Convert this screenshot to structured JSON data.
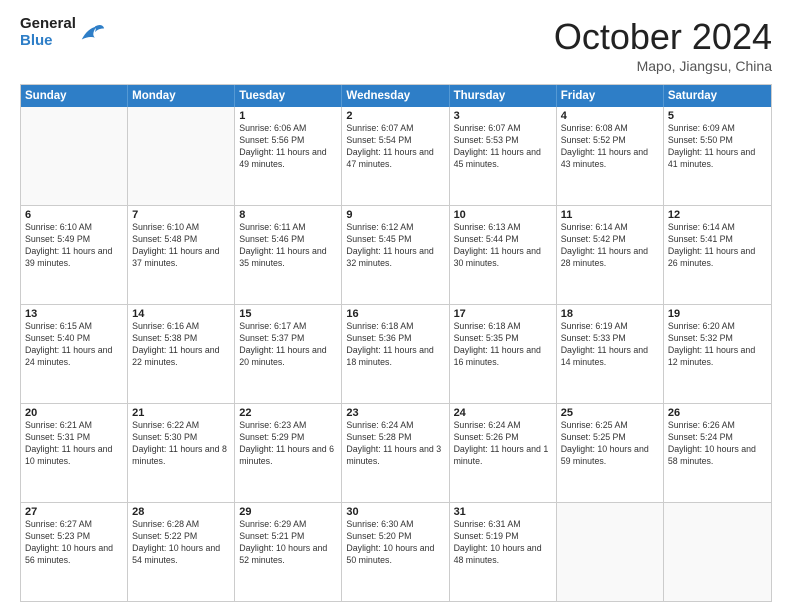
{
  "logo": {
    "line1": "General",
    "line2": "Blue"
  },
  "title": "October 2024",
  "location": "Mapo, Jiangsu, China",
  "header_days": [
    "Sunday",
    "Monday",
    "Tuesday",
    "Wednesday",
    "Thursday",
    "Friday",
    "Saturday"
  ],
  "weeks": [
    [
      {
        "day": "",
        "info": ""
      },
      {
        "day": "",
        "info": ""
      },
      {
        "day": "1",
        "info": "Sunrise: 6:06 AM\nSunset: 5:56 PM\nDaylight: 11 hours and 49 minutes."
      },
      {
        "day": "2",
        "info": "Sunrise: 6:07 AM\nSunset: 5:54 PM\nDaylight: 11 hours and 47 minutes."
      },
      {
        "day": "3",
        "info": "Sunrise: 6:07 AM\nSunset: 5:53 PM\nDaylight: 11 hours and 45 minutes."
      },
      {
        "day": "4",
        "info": "Sunrise: 6:08 AM\nSunset: 5:52 PM\nDaylight: 11 hours and 43 minutes."
      },
      {
        "day": "5",
        "info": "Sunrise: 6:09 AM\nSunset: 5:50 PM\nDaylight: 11 hours and 41 minutes."
      }
    ],
    [
      {
        "day": "6",
        "info": "Sunrise: 6:10 AM\nSunset: 5:49 PM\nDaylight: 11 hours and 39 minutes."
      },
      {
        "day": "7",
        "info": "Sunrise: 6:10 AM\nSunset: 5:48 PM\nDaylight: 11 hours and 37 minutes."
      },
      {
        "day": "8",
        "info": "Sunrise: 6:11 AM\nSunset: 5:46 PM\nDaylight: 11 hours and 35 minutes."
      },
      {
        "day": "9",
        "info": "Sunrise: 6:12 AM\nSunset: 5:45 PM\nDaylight: 11 hours and 32 minutes."
      },
      {
        "day": "10",
        "info": "Sunrise: 6:13 AM\nSunset: 5:44 PM\nDaylight: 11 hours and 30 minutes."
      },
      {
        "day": "11",
        "info": "Sunrise: 6:14 AM\nSunset: 5:42 PM\nDaylight: 11 hours and 28 minutes."
      },
      {
        "day": "12",
        "info": "Sunrise: 6:14 AM\nSunset: 5:41 PM\nDaylight: 11 hours and 26 minutes."
      }
    ],
    [
      {
        "day": "13",
        "info": "Sunrise: 6:15 AM\nSunset: 5:40 PM\nDaylight: 11 hours and 24 minutes."
      },
      {
        "day": "14",
        "info": "Sunrise: 6:16 AM\nSunset: 5:38 PM\nDaylight: 11 hours and 22 minutes."
      },
      {
        "day": "15",
        "info": "Sunrise: 6:17 AM\nSunset: 5:37 PM\nDaylight: 11 hours and 20 minutes."
      },
      {
        "day": "16",
        "info": "Sunrise: 6:18 AM\nSunset: 5:36 PM\nDaylight: 11 hours and 18 minutes."
      },
      {
        "day": "17",
        "info": "Sunrise: 6:18 AM\nSunset: 5:35 PM\nDaylight: 11 hours and 16 minutes."
      },
      {
        "day": "18",
        "info": "Sunrise: 6:19 AM\nSunset: 5:33 PM\nDaylight: 11 hours and 14 minutes."
      },
      {
        "day": "19",
        "info": "Sunrise: 6:20 AM\nSunset: 5:32 PM\nDaylight: 11 hours and 12 minutes."
      }
    ],
    [
      {
        "day": "20",
        "info": "Sunrise: 6:21 AM\nSunset: 5:31 PM\nDaylight: 11 hours and 10 minutes."
      },
      {
        "day": "21",
        "info": "Sunrise: 6:22 AM\nSunset: 5:30 PM\nDaylight: 11 hours and 8 minutes."
      },
      {
        "day": "22",
        "info": "Sunrise: 6:23 AM\nSunset: 5:29 PM\nDaylight: 11 hours and 6 minutes."
      },
      {
        "day": "23",
        "info": "Sunrise: 6:24 AM\nSunset: 5:28 PM\nDaylight: 11 hours and 3 minutes."
      },
      {
        "day": "24",
        "info": "Sunrise: 6:24 AM\nSunset: 5:26 PM\nDaylight: 11 hours and 1 minute."
      },
      {
        "day": "25",
        "info": "Sunrise: 6:25 AM\nSunset: 5:25 PM\nDaylight: 10 hours and 59 minutes."
      },
      {
        "day": "26",
        "info": "Sunrise: 6:26 AM\nSunset: 5:24 PM\nDaylight: 10 hours and 58 minutes."
      }
    ],
    [
      {
        "day": "27",
        "info": "Sunrise: 6:27 AM\nSunset: 5:23 PM\nDaylight: 10 hours and 56 minutes."
      },
      {
        "day": "28",
        "info": "Sunrise: 6:28 AM\nSunset: 5:22 PM\nDaylight: 10 hours and 54 minutes."
      },
      {
        "day": "29",
        "info": "Sunrise: 6:29 AM\nSunset: 5:21 PM\nDaylight: 10 hours and 52 minutes."
      },
      {
        "day": "30",
        "info": "Sunrise: 6:30 AM\nSunset: 5:20 PM\nDaylight: 10 hours and 50 minutes."
      },
      {
        "day": "31",
        "info": "Sunrise: 6:31 AM\nSunset: 5:19 PM\nDaylight: 10 hours and 48 minutes."
      },
      {
        "day": "",
        "info": ""
      },
      {
        "day": "",
        "info": ""
      }
    ]
  ]
}
